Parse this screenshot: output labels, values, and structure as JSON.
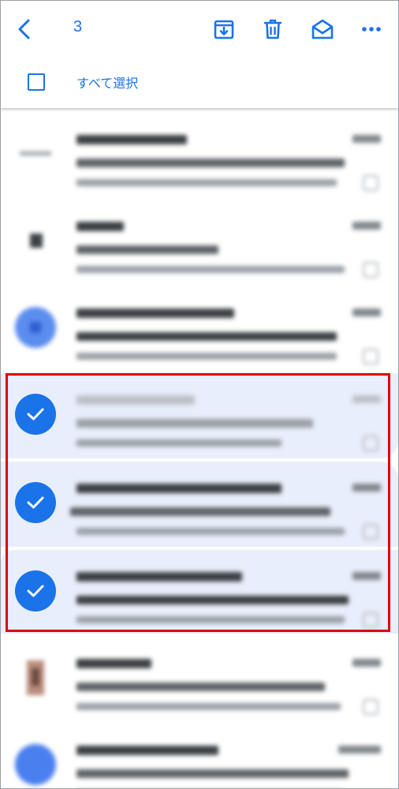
{
  "toolbar": {
    "selected_count": "3",
    "back_icon": "back-chevron-icon",
    "archive_icon": "archive-icon",
    "delete_icon": "trash-icon",
    "mark_read_icon": "envelope-open-icon",
    "more_icon": "more-horiz-icon",
    "select_all_label": "すべて選択"
  },
  "colors": {
    "accent": "#1a73e8",
    "selected_row_bg": "#e8eefb",
    "highlight_border": "#e00000"
  },
  "rows": [
    {
      "selected": false,
      "avatar": "gray-logo"
    },
    {
      "selected": false,
      "avatar": "dark-logo"
    },
    {
      "selected": false,
      "avatar": "blue-circle"
    },
    {
      "selected": true,
      "avatar": "checkmark-icon"
    },
    {
      "selected": true,
      "avatar": "checkmark-icon"
    },
    {
      "selected": true,
      "avatar": "checkmark-icon"
    },
    {
      "selected": false,
      "avatar": "photo"
    },
    {
      "selected": false,
      "avatar": "blue-circle"
    }
  ]
}
